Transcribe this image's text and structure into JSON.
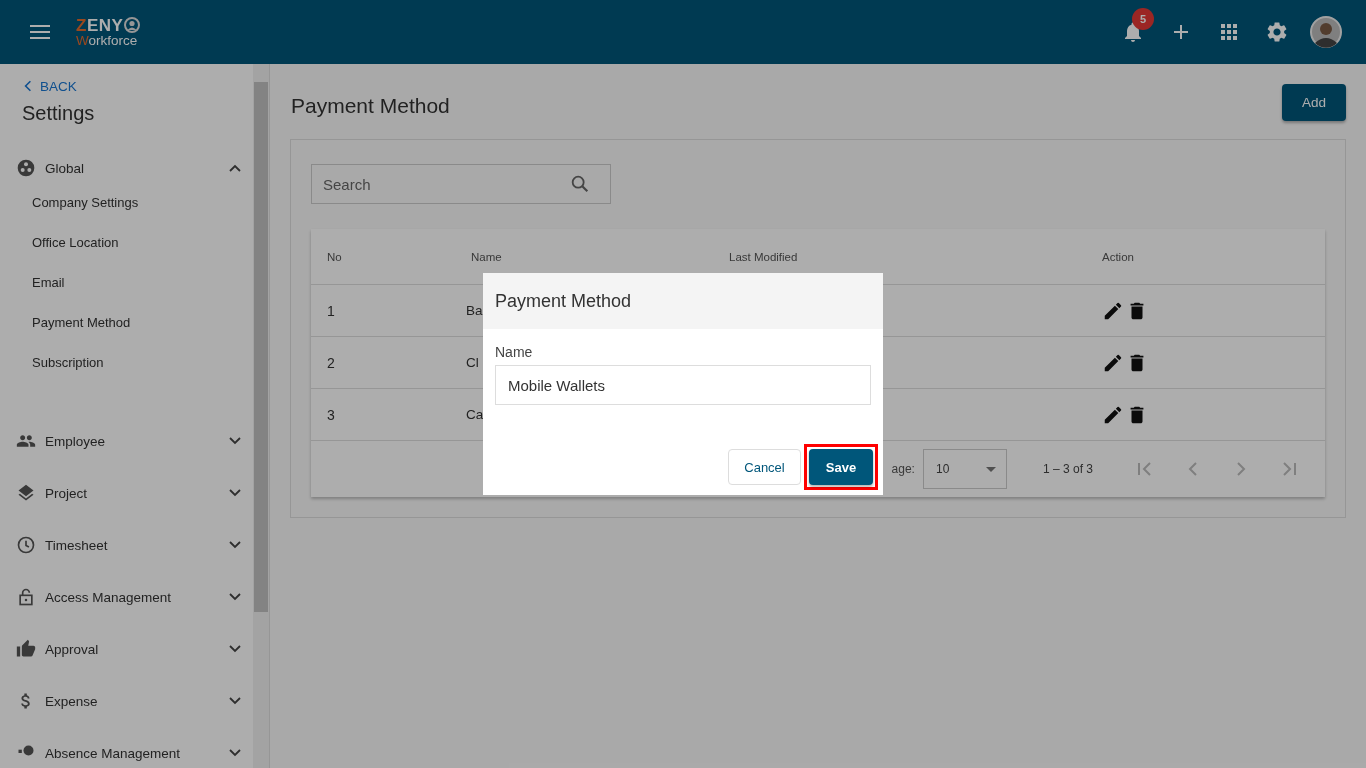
{
  "header": {
    "logo_top": "ZENY",
    "logo_bottom": "Workforce",
    "notification_count": "5"
  },
  "sidebar": {
    "back": "BACK",
    "title": "Settings",
    "groups": [
      {
        "label": "Global",
        "expanded": true,
        "children": [
          "Company Settings",
          "Office Location",
          "Email",
          "Payment Method",
          "Subscription"
        ]
      },
      {
        "label": "Employee",
        "expanded": false
      },
      {
        "label": "Project",
        "expanded": false
      },
      {
        "label": "Timesheet",
        "expanded": false
      },
      {
        "label": "Access Management",
        "expanded": false
      },
      {
        "label": "Approval",
        "expanded": false
      },
      {
        "label": "Expense",
        "expanded": false
      },
      {
        "label": "Absence Management",
        "expanded": false
      }
    ]
  },
  "page": {
    "title": "Payment Method",
    "add_button": "Add",
    "search": {
      "placeholder": "Search"
    }
  },
  "table": {
    "columns": [
      "No",
      "Name",
      "Last Modified",
      "Action"
    ],
    "rows": [
      {
        "no": "1",
        "name": "Ba"
      },
      {
        "no": "2",
        "name": "Cl"
      },
      {
        "no": "3",
        "name": "Ca"
      }
    ]
  },
  "paginator": {
    "label": "age:",
    "page_size": "10",
    "range": "1 – 3 of 3"
  },
  "dialog": {
    "title": "Payment Method",
    "field_label": "Name",
    "field_value": "Mobile Wallets",
    "cancel": "Cancel",
    "save": "Save",
    "save_highlighted": true
  }
}
